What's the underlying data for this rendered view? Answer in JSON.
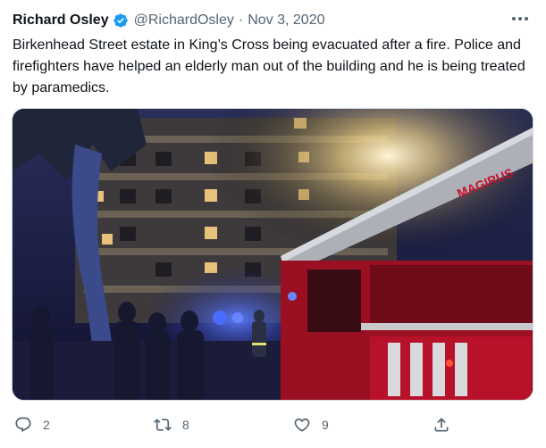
{
  "tweet": {
    "author_name": "Richard Osley",
    "verified": true,
    "handle": "@RichardOsley",
    "separator": "·",
    "date": "Nov 3, 2020",
    "text": "Birkenhead Street estate in King’s Cross being evacuated after a fire. Police and firefighters have helped an elderly man out of the building and he is being treated by paramedics.",
    "media": {
      "truck_label": "MAGIRUS"
    },
    "actions": {
      "reply_count": "2",
      "retweet_count": "8",
      "like_count": "9"
    }
  },
  "colors": {
    "verified_blue": "#1d9bf0",
    "text_primary": "#0f1419",
    "text_secondary": "#536471",
    "police_light_blue": "#3b5bff",
    "fire_truck_red": "#c8102e"
  },
  "icons": {
    "verified": "verified-badge-icon",
    "more": "more-dots-icon",
    "reply": "reply-bubble-icon",
    "retweet": "retweet-icon",
    "like": "heart-icon",
    "share": "share-icon"
  }
}
